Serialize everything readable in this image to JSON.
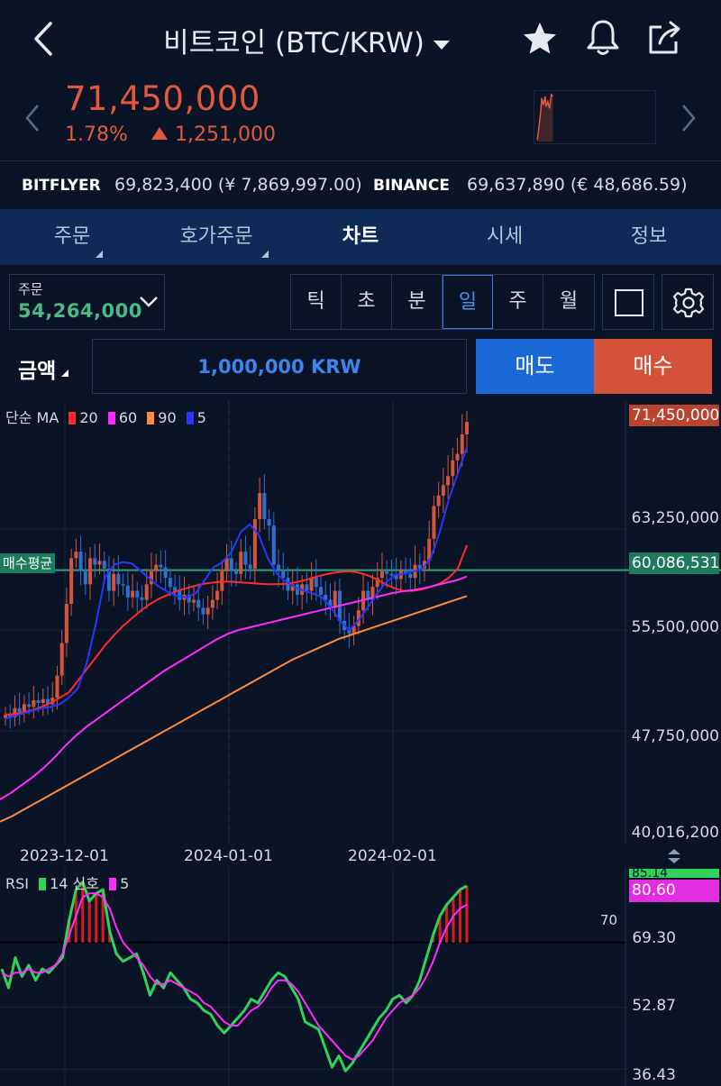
{
  "header": {
    "title": "비트코인 (BTC/KRW)",
    "icons": {
      "back": "chevron-left-icon",
      "dropdown": "caret-down-icon",
      "favorite": "star-icon",
      "alert": "bell-icon",
      "share": "share-icon"
    }
  },
  "ticker": {
    "price": "71,450,000",
    "change_pct": "1.78%",
    "change_amount": "1,251,000",
    "color_up": "#e05a3f"
  },
  "exchanges": [
    {
      "name": "BITFLYER",
      "value": "69,823,400 (¥ 7,869,997.00)"
    },
    {
      "name": "BINANCE",
      "value": "69,637,890 (€ 48,686.59)"
    }
  ],
  "tabs": [
    {
      "label": "주문",
      "active": false
    },
    {
      "label": "호가주문",
      "active": false
    },
    {
      "label": "차트",
      "active": true
    },
    {
      "label": "시세",
      "active": false
    },
    {
      "label": "정보",
      "active": false
    }
  ],
  "order": {
    "label": "주문",
    "value": "54,264,000"
  },
  "periods": [
    "틱",
    "초",
    "분",
    "일",
    "주",
    "월"
  ],
  "active_period": "일",
  "amount": {
    "label": "금액",
    "value": "1,000,000 KRW"
  },
  "buttons": {
    "sell": "매도",
    "buy": "매수"
  },
  "colors": {
    "bg": "#0b1426",
    "tabbar": "#0f2a57",
    "sell": "#1a67d6",
    "buy": "#d4523a",
    "candle_up": "#d4553a",
    "candle_down": "#2f6fd0",
    "avg_line": "#2aa37a"
  },
  "ma_legend": {
    "label": "단순 MA",
    "items": [
      {
        "period": "20",
        "color": "#ff2a2a"
      },
      {
        "period": "60",
        "color": "#ff2cff"
      },
      {
        "period": "90",
        "color": "#ff8a3c"
      },
      {
        "period": "5",
        "color": "#2438ff"
      }
    ]
  },
  "rsi_legend": {
    "label": "RSI",
    "period": "14",
    "signal_label": "신호",
    "signal_period": "5",
    "rsi_color": "#2fd35a",
    "signal_color": "#ff2cff"
  },
  "avg_price": {
    "label": "매수평균",
    "value": "60,086,531"
  },
  "chart_data": [
    {
      "type": "candlestick",
      "x_ticks": [
        "2023-12-01",
        "2024-01-01",
        "2024-02-01"
      ],
      "y_ticks": [
        "63,250,000",
        "55,500,000",
        "47,750,000",
        "40,016,200"
      ],
      "ylim": [
        40016200,
        72500000
      ],
      "last_price": "71,450,000",
      "grid": true,
      "closes": [
        49000000,
        48800000,
        49500000,
        49200000,
        49800000,
        49600000,
        50100000,
        49900000,
        50200000,
        49800000,
        50300000,
        52000000,
        54500000,
        57500000,
        61000000,
        61500000,
        60000000,
        59000000,
        61000000,
        60500000,
        60800000,
        60200000,
        58500000,
        59800000,
        59000000,
        58900000,
        58000000,
        58500000,
        58000000,
        57800000,
        59000000,
        60000000,
        60500000,
        60300000,
        59500000,
        58800000,
        58500000,
        57800000,
        58200000,
        57600000,
        57800000,
        57200000,
        56700000,
        57200000,
        57800000,
        58500000,
        60000000,
        61000000,
        60000000,
        59800000,
        61500000,
        60500000,
        60200000,
        64000000,
        66000000,
        64000000,
        63500000,
        60500000,
        60000000,
        59500000,
        58500000,
        59000000,
        58200000,
        59000000,
        58500000,
        59500000,
        58800000,
        58200000,
        57800000,
        57200000,
        58500000,
        56200000,
        55500000,
        55200000,
        55800000,
        57000000,
        58500000,
        57800000,
        58800000,
        59500000,
        60000000,
        59800000,
        59700000,
        59400000,
        60100000,
        59800000,
        59500000,
        60500000,
        60200000,
        60800000,
        62500000,
        65000000,
        65800000,
        66600000,
        67300000,
        68500000,
        69000000,
        70500000,
        71450000
      ],
      "series": [
        {
          "name": "20",
          "values": [
            49000000,
            49050000,
            49180000,
            49350000,
            49600000,
            49900000,
            50300000,
            50700000,
            51600000,
            52500000,
            53400000,
            54300000,
            55100000,
            55800000,
            56400000,
            57000000,
            57500000,
            57900000,
            58200000,
            58500000,
            58700000,
            58900000,
            59050000,
            59150000,
            59200000,
            59200000,
            59150000,
            59100000,
            59050000,
            59000000,
            59000000,
            59050000,
            59150000,
            59300000,
            59500000,
            59700000,
            59850000,
            59950000,
            60000000,
            59900000,
            59700000,
            59400000,
            59000000,
            58700000,
            58500000,
            58500000,
            58600000,
            58800000,
            59050000,
            59500000,
            60200000,
            62000000
          ]
        },
        {
          "name": "60",
          "values": [
            42500000,
            43000000,
            43600000,
            44200000,
            44900000,
            45700000,
            46600000,
            47400000,
            48100000,
            48700000,
            49300000,
            49900000,
            50500000,
            51100000,
            51700000,
            52300000,
            52800000,
            53300000,
            53800000,
            54300000,
            54800000,
            55200000,
            55500000,
            55700000,
            55900000,
            56100000,
            56300000,
            56500000,
            56700000,
            56900000,
            57100000,
            57300000,
            57500000,
            57700000,
            57900000,
            58100000,
            58300000,
            58450000,
            58550000,
            58700000,
            58900000,
            59100000,
            59300000,
            59600000
          ]
        },
        {
          "name": "90",
          "values": [
            40800000,
            41200000,
            41700000,
            42200000,
            42700000,
            43200000,
            43700000,
            44200000,
            44700000,
            45200000,
            45700000,
            46200000,
            46700000,
            47200000,
            47700000,
            48200000,
            48700000,
            49200000,
            49700000,
            50200000,
            50700000,
            51200000,
            51700000,
            52200000,
            52700000,
            53200000,
            53600000,
            54000000,
            54400000,
            54800000,
            55100000,
            55400000,
            55700000,
            56000000,
            56300000,
            56600000,
            56900000,
            57200000,
            57500000,
            57800000,
            58100000
          ]
        },
        {
          "name": "5",
          "values": [
            48700000,
            48900000,
            49100000,
            49300000,
            49500000,
            49600000,
            49800000,
            50300000,
            51000000,
            53000000,
            56000000,
            59500000,
            60500000,
            60700000,
            60600000,
            60000000,
            59400000,
            58800000,
            58400000,
            58100000,
            58000000,
            58300000,
            59300000,
            60300000,
            60700000,
            61500000,
            63000000,
            63600000,
            62800000,
            61000000,
            59800000,
            59200000,
            58800000,
            58500000,
            58300000,
            58000000,
            57200000,
            56200000,
            55500000,
            56200000,
            57200000,
            58200000,
            59100000,
            59700000,
            59800000,
            60000000,
            60100000,
            61000000,
            63000000,
            65500000,
            67500000,
            69500000
          ]
        }
      ]
    },
    {
      "type": "line",
      "title": "RSI",
      "y_ticks": [
        "69.30",
        "52.87",
        "36.43"
      ],
      "ylim": [
        32,
        90
      ],
      "reference_line": 70,
      "last_values": {
        "rsi": "85.14",
        "signal": "80.60"
      },
      "series": [
        {
          "name": "14",
          "values": [
            63,
            58,
            66,
            61,
            64,
            60,
            63,
            62,
            64,
            66,
            76,
            84,
            86,
            81,
            83,
            84,
            73,
            67,
            65,
            66,
            67,
            62,
            56,
            60,
            58,
            62,
            60,
            58,
            55,
            54,
            52,
            51,
            48,
            46,
            48,
            50,
            52,
            55,
            54,
            57,
            60,
            62,
            61,
            58,
            55,
            49,
            48,
            47,
            42,
            37,
            40,
            36,
            38,
            41,
            44,
            47,
            50,
            52,
            55,
            56,
            54,
            56,
            60,
            66,
            72,
            77,
            80,
            82,
            84,
            85
          ]
        },
        {
          "name": "신호",
          "values": [
            62,
            61,
            62,
            62,
            63,
            62,
            62,
            63,
            64,
            67,
            72,
            77,
            82,
            83,
            83,
            82,
            79,
            74,
            70,
            68,
            66,
            64,
            61,
            59,
            59,
            60,
            59,
            58,
            57,
            56,
            54,
            53,
            51,
            49,
            48,
            48,
            50,
            52,
            53,
            55,
            58,
            60,
            60,
            59,
            57,
            54,
            51,
            48,
            46,
            44,
            42,
            40,
            39,
            40,
            42,
            44,
            47,
            50,
            52,
            54,
            55,
            56,
            58,
            61,
            65,
            70,
            74,
            77,
            79,
            80
          ]
        }
      ]
    }
  ]
}
